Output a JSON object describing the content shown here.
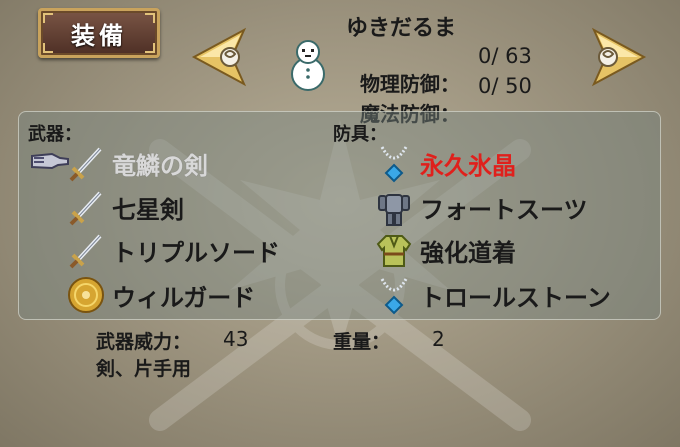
{
  "header": {
    "title": "装備"
  },
  "character": {
    "name": "ゆきだるま",
    "physical_defense": {
      "label": "物理防御：",
      "value": "0/ 63"
    },
    "magic_defense": {
      "label": "魔法防御：",
      "value": "0/ 50"
    }
  },
  "weapons": {
    "section_label": "武器：",
    "items": [
      {
        "name": "竜鱗の剣",
        "icon": "sword-icon",
        "equipped": true
      },
      {
        "name": "七星剣",
        "icon": "sword-icon"
      },
      {
        "name": "トリプルソード",
        "icon": "sword-icon"
      },
      {
        "name": "ウィルガード",
        "icon": "round-shield-icon"
      }
    ]
  },
  "armor": {
    "section_label": "防具：",
    "items": [
      {
        "name": "永久氷晶",
        "icon": "necklace-icon",
        "color": "#e0201c"
      },
      {
        "name": "フォートスーツ",
        "icon": "plate-armor-icon"
      },
      {
        "name": "強化道着",
        "icon": "robe-icon"
      },
      {
        "name": "トロールストーン",
        "icon": "necklace-icon"
      }
    ]
  },
  "details": {
    "weapon_power_label": "武器威力：",
    "weapon_power_value": "43",
    "weapon_type": "剣、片手用",
    "weight_label": "重量：",
    "weight_value": "2"
  }
}
